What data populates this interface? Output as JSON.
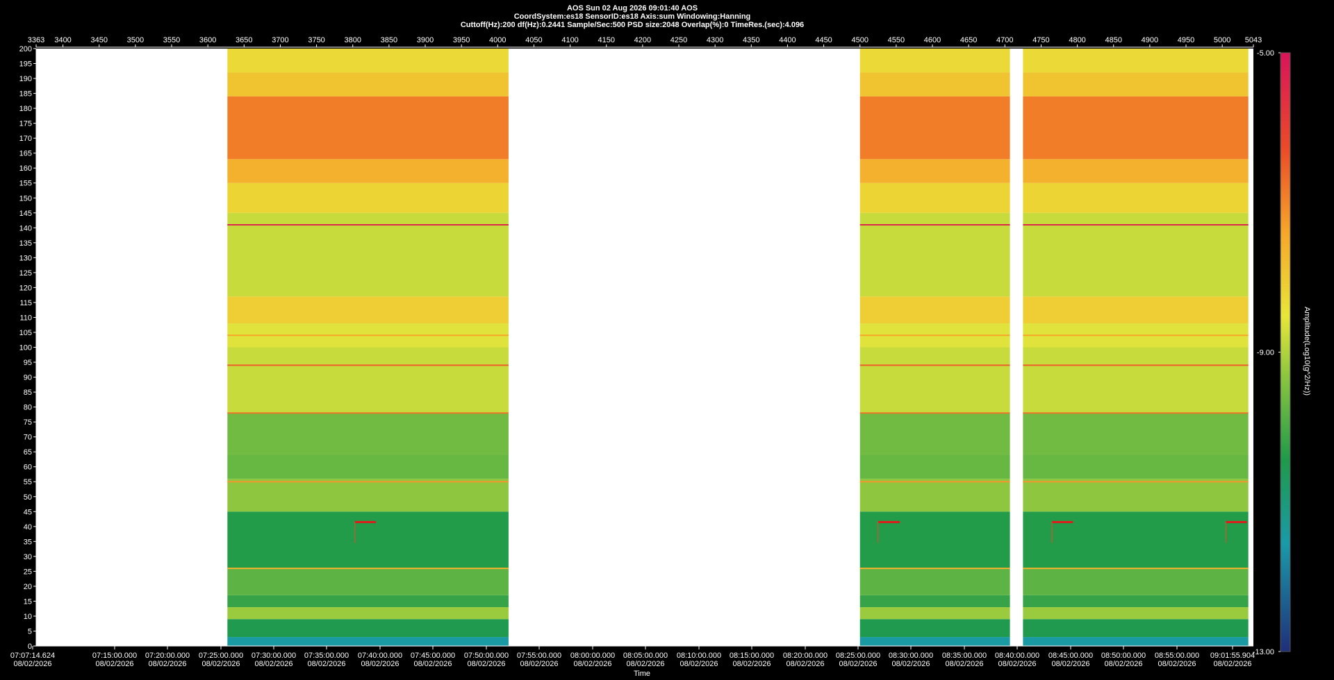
{
  "header": {
    "line1": "AOS  Sun 02 Aug 2026 09:01:40  AOS",
    "line2": "CoordSystem:es18   SensorID:es18    Axis:sum    Windowing:Hanning",
    "line3": "Cuttoff(Hz):200      df(Hz):0.2441       Sample/Sec:500       PSD size:2048        Overlap(%):0        TimeRes.(sec):4.096"
  },
  "chart_data": {
    "type": "heatmap",
    "title": "",
    "xlabel": "Time",
    "ylabel": "",
    "colorbar_label": "Amplitude(Log10(g^2/Hz))",
    "colorbar_range": [
      -13.0,
      -5.0
    ],
    "colorbar_ticks": [
      "-5.00",
      "-9.00",
      "-13.00"
    ],
    "frequency_range": [
      0,
      200
    ],
    "y_ticks": [
      200,
      195,
      190,
      185,
      180,
      175,
      170,
      165,
      160,
      155,
      150,
      145,
      140,
      135,
      130,
      125,
      120,
      115,
      110,
      105,
      100,
      95,
      90,
      85,
      80,
      75,
      70,
      65,
      60,
      55,
      50,
      45,
      40,
      35,
      30,
      25,
      20,
      15,
      10,
      5,
      0
    ],
    "top_axis_range": [
      3363,
      5043
    ],
    "top_ticks": [
      3363,
      3400,
      3450,
      3500,
      3550,
      3600,
      3650,
      3700,
      3750,
      3800,
      3850,
      3900,
      3950,
      4000,
      4050,
      4100,
      4150,
      4200,
      4250,
      4300,
      4350,
      4400,
      4450,
      4500,
      4550,
      4600,
      4650,
      4700,
      4750,
      4800,
      4850,
      4900,
      4950,
      5000,
      5043
    ],
    "time_ticks": [
      {
        "time": "07:07:14.624",
        "date": "08/02/2026"
      },
      {
        "time": "07:15:00.000",
        "date": "08/02/2026"
      },
      {
        "time": "07:20:00.000",
        "date": "08/02/2026"
      },
      {
        "time": "07:25:00.000",
        "date": "08/02/2026"
      },
      {
        "time": "07:30:00.000",
        "date": "08/02/2026"
      },
      {
        "time": "07:35:00.000",
        "date": "08/02/2026"
      },
      {
        "time": "07:40:00.000",
        "date": "08/02/2026"
      },
      {
        "time": "07:45:00.000",
        "date": "08/02/2026"
      },
      {
        "time": "07:50:00.000",
        "date": "08/02/2026"
      },
      {
        "time": "07:55:00.000",
        "date": "08/02/2026"
      },
      {
        "time": "08:00:00.000",
        "date": "08/02/2026"
      },
      {
        "time": "08:05:00.000",
        "date": "08/02/2026"
      },
      {
        "time": "08:10:00.000",
        "date": "08/02/2026"
      },
      {
        "time": "08:15:00.000",
        "date": "08/02/2026"
      },
      {
        "time": "08:20:00.000",
        "date": "08/02/2026"
      },
      {
        "time": "08:25:00.000",
        "date": "08/02/2026"
      },
      {
        "time": "08:30:00.000",
        "date": "08/02/2026"
      },
      {
        "time": "08:35:00.000",
        "date": "08/02/2026"
      },
      {
        "time": "08:40:00.000",
        "date": "08/02/2026"
      },
      {
        "time": "08:45:00.000",
        "date": "08/02/2026"
      },
      {
        "time": "08:50:00.000",
        "date": "08/02/2026"
      },
      {
        "time": "08:55:00.000",
        "date": "08/02/2026"
      },
      {
        "time": "09:01:55.904",
        "date": "08/02/2026"
      }
    ],
    "data_segments": [
      [
        3627,
        4015
      ],
      [
        4500,
        4707
      ],
      [
        4725,
        5036
      ]
    ],
    "frequency_band_amplitudes": [
      {
        "f_low": 0,
        "f_high": 3,
        "amplitude": -11.5
      },
      {
        "f_low": 3,
        "f_high": 9,
        "amplitude": -10.5
      },
      {
        "f_low": 9,
        "f_high": 13,
        "amplitude": -9.2
      },
      {
        "f_low": 13,
        "f_high": 17,
        "amplitude": -10.2
      },
      {
        "f_low": 17,
        "f_high": 26,
        "amplitude": -9.8
      },
      {
        "f_low": 26,
        "f_high": 45,
        "amplitude": -10.4
      },
      {
        "f_low": 45,
        "f_high": 56,
        "amplitude": -9.3
      },
      {
        "f_low": 56,
        "f_high": 64,
        "amplitude": -9.7
      },
      {
        "f_low": 64,
        "f_high": 78,
        "amplitude": -9.6
      },
      {
        "f_low": 78,
        "f_high": 100,
        "amplitude": -8.8
      },
      {
        "f_low": 100,
        "f_high": 108,
        "amplitude": -8.6
      },
      {
        "f_low": 108,
        "f_high": 117,
        "amplitude": -8.1
      },
      {
        "f_low": 117,
        "f_high": 145,
        "amplitude": -8.8
      },
      {
        "f_low": 145,
        "f_high": 155,
        "amplitude": -8.2
      },
      {
        "f_low": 155,
        "f_high": 163,
        "amplitude": -7.6
      },
      {
        "f_low": 163,
        "f_high": 184,
        "amplitude": -6.9
      },
      {
        "f_low": 184,
        "f_high": 192,
        "amplitude": -7.9
      },
      {
        "f_low": 192,
        "f_high": 200,
        "amplitude": -8.3
      }
    ],
    "spectral_lines": [
      {
        "frequency": 141,
        "amplitude": -5.4
      },
      {
        "frequency": 94,
        "amplitude": -6.5
      },
      {
        "frequency": 78,
        "amplitude": -6.8
      },
      {
        "frequency": 55,
        "amplitude": -7.2
      },
      {
        "frequency": 104,
        "amplitude": -7.4
      },
      {
        "frequency": 26,
        "amplitude": -7.6
      }
    ],
    "tone_bursts": [
      {
        "frequency": 41.5,
        "x_start": 3803,
        "x_end": 3832
      },
      {
        "frequency": 41.5,
        "x_start": 4525,
        "x_end": 4555
      },
      {
        "frequency": 41.5,
        "x_start": 4765,
        "x_end": 4794
      },
      {
        "frequency": 41.5,
        "x_start": 5005,
        "x_end": 5034
      }
    ]
  }
}
